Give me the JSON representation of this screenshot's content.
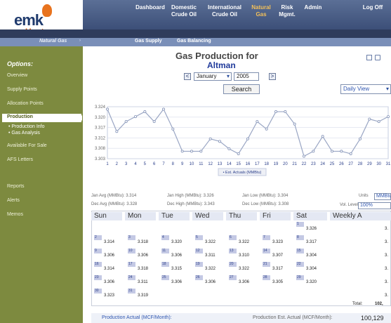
{
  "brand": {
    "name": "emk",
    "sub": "Upstream"
  },
  "topnav": [
    {
      "label": "Dashboard"
    },
    {
      "label": "Domestic Crude Oil"
    },
    {
      "label": "International Crude Oil"
    },
    {
      "label": "Natural Gas",
      "active": true
    },
    {
      "label": "Risk Mgmt."
    },
    {
      "label": "Admin"
    },
    {
      "label": "Log Off"
    }
  ],
  "subnav": {
    "section": "Natural Gas",
    "items": [
      "Gas Supply",
      "Gas Balancing"
    ]
  },
  "sidebar": {
    "title": "Options:",
    "items": [
      "Overview",
      "Supply Points",
      "Allocation Points",
      "Production",
      "Production Info",
      "Gas Analysis",
      "Available For Sale",
      "AFS Letters",
      "Reports",
      "Alerts",
      "Memos"
    ]
  },
  "page": {
    "title": "Gas Production for",
    "subject": "Altman"
  },
  "filters": {
    "month": "January",
    "year": "2005",
    "search": "Search",
    "view": "Daily View"
  },
  "chart_data": {
    "type": "line",
    "x": [
      1,
      2,
      3,
      4,
      5,
      6,
      7,
      8,
      9,
      10,
      11,
      12,
      13,
      14,
      15,
      16,
      17,
      18,
      19,
      20,
      21,
      22,
      23,
      24,
      25,
      26,
      27,
      28,
      29,
      30,
      31
    ],
    "series": [
      {
        "name": "Est. Actuals (MMBtu)",
        "values": [
          3.323,
          3.314,
          3.318,
          3.32,
          3.322,
          3.318,
          3.323,
          3.315,
          3.306,
          3.306,
          3.306,
          3.311,
          3.31,
          3.307,
          3.305,
          3.311,
          3.318,
          3.315,
          3.322,
          3.322,
          3.317,
          3.304,
          3.306,
          3.312,
          3.306,
          3.306,
          3.305,
          3.311,
          3.319,
          3.318,
          3.32
        ]
      }
    ],
    "yticks": [
      "3.324",
      "3.320",
      "3.317",
      "3.312",
      "3.308",
      "3.303"
    ],
    "ylim": [
      3.303,
      3.324
    ],
    "legend": "Est. Actuals (MMBtu)"
  },
  "stats": {
    "jan_avg": "Jan Avg (MMBtu): 3.314",
    "jan_high": "Jan High (MMBtu): 3.326",
    "jan_low": "Jan Low (MMBtu): 3.304",
    "dec_avg": "Dec Avg (MMBtu): 3.328",
    "dec_high": "Dec High (MMBtu): 3.343",
    "dec_low": "Dec Low (MMBtu): 3.308",
    "units_label": "Units",
    "units_value": "MMBtu",
    "vol_label": "Vol. Level",
    "vol_value": "100%"
  },
  "calendar": {
    "days": [
      "Sun",
      "Mon",
      "Tue",
      "Wed",
      "Thu",
      "Fri",
      "Sat",
      "Weekly A"
    ],
    "rows": [
      {
        "dates": [
          "",
          "",
          "",
          "",
          "",
          "",
          "1"
        ],
        "values": [
          "",
          "",
          "",
          "",
          "",
          "",
          "3.326"
        ],
        "weekly": "3."
      },
      {
        "dates": [
          "2",
          "3",
          "4",
          "5",
          "6",
          "7",
          "8"
        ],
        "values": [
          "3.314",
          "3.318",
          "3.320",
          "3.322",
          "3.322",
          "3.323",
          "3.317"
        ],
        "weekly": "3."
      },
      {
        "dates": [
          "9",
          "10",
          "11",
          "12",
          "13",
          "14",
          "15"
        ],
        "values": [
          "3.306",
          "3.306",
          "3.306",
          "3.311",
          "3.310",
          "3.307",
          "3.304"
        ],
        "weekly": "3."
      },
      {
        "dates": [
          "16",
          "17",
          "18",
          "19",
          "20",
          "21",
          "22"
        ],
        "values": [
          "3.314",
          "3.318",
          "3.315",
          "3.322",
          "3.322",
          "3.317",
          "3.304"
        ],
        "weekly": "3."
      },
      {
        "dates": [
          "23",
          "24",
          "25",
          "26",
          "27",
          "28",
          "29"
        ],
        "values": [
          "3.306",
          "3.311",
          "3.306",
          "3.306",
          "3.306",
          "3.305",
          "3.320"
        ],
        "weekly": "3."
      },
      {
        "dates": [
          "30",
          "31",
          "",
          "",
          "",
          "",
          ""
        ],
        "values": [
          "3.323",
          "3.319",
          "",
          "",
          "",
          "",
          ""
        ],
        "weekly": "3."
      }
    ],
    "total_label": "Total:",
    "total_value": "102,"
  },
  "bottom": {
    "left_label": "Production Actual (MCF/Month):",
    "right_label": "Production Est. Actual (MCF/Month):",
    "right_value": "100,129"
  }
}
